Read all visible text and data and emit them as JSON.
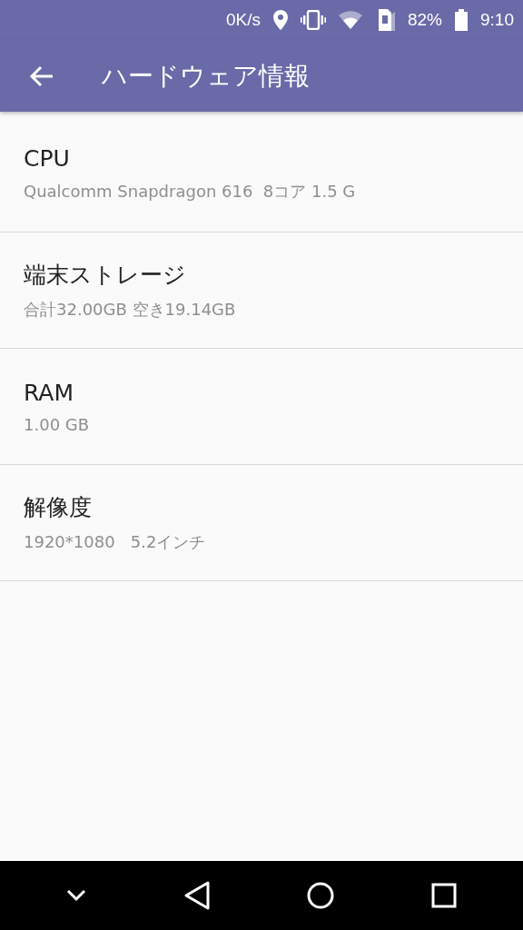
{
  "status_bar": {
    "speed": "0K/s",
    "battery": "82%",
    "time": "9:10"
  },
  "app_bar": {
    "title": "ハードウェア情報"
  },
  "items": [
    {
      "title": "CPU",
      "summary": "Qualcomm Snapdragon 616  8コア 1.5 G"
    },
    {
      "title": "端末ストレージ",
      "summary": "合計32.00GB 空き19.14GB"
    },
    {
      "title": "RAM",
      "summary": "1.00 GB"
    },
    {
      "title": "解像度",
      "summary": "1920*1080   5.2インチ"
    }
  ]
}
